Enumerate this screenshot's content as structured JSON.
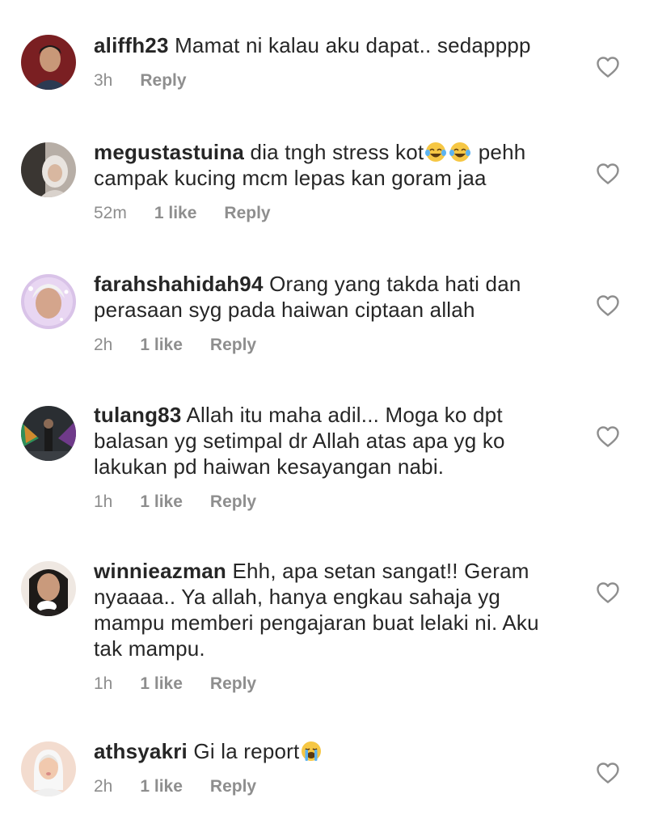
{
  "comments": [
    {
      "username": "aliffh23",
      "text": "Mamat ni kalau aku dapat.. sedapppp",
      "time": "3h",
      "likes": "",
      "reply": "Reply"
    },
    {
      "username": "megustastuina",
      "text_before_emoji": "dia tngh stress kot",
      "emoji": "😂😂",
      "text_after_emoji": " pehh campak kucing mcm lepas kan goram jaa",
      "time": "52m",
      "likes": "1 like",
      "reply": "Reply"
    },
    {
      "username": "farahshahidah94",
      "text": "Orang yang takda hati dan perasaan syg pada haiwan ciptaan allah",
      "time": "2h",
      "likes": "1 like",
      "reply": "Reply"
    },
    {
      "username": "tulang83",
      "text": "Allah itu maha adil... Moga ko dpt balasan yg setimpal dr Allah atas apa yg ko lakukan pd haiwan kesayangan nabi.",
      "time": "1h",
      "likes": "1 like",
      "reply": "Reply"
    },
    {
      "username": "winnieazman",
      "text": "Ehh, apa setan sangat!! Geram nyaaaa.. Ya allah, hanya engkau sahaja yg mampu memberi pengajaran buat lelaki ni. Aku tak mampu.",
      "time": "1h",
      "likes": "1 like",
      "reply": "Reply"
    },
    {
      "username": "athsyakri",
      "text": "Gi la report",
      "emoji": "😭",
      "time": "2h",
      "likes": "1 like",
      "reply": "Reply"
    }
  ],
  "colors": {
    "text": "#262626",
    "meta": "#8e8e8e",
    "heart_stroke": "#8e8e8e",
    "emoji_face": "#f6c744"
  },
  "icons": {
    "like": "heart-outline-icon",
    "laugh": "face-with-tears-of-joy-emoji",
    "cry": "loudly-crying-face-emoji"
  }
}
